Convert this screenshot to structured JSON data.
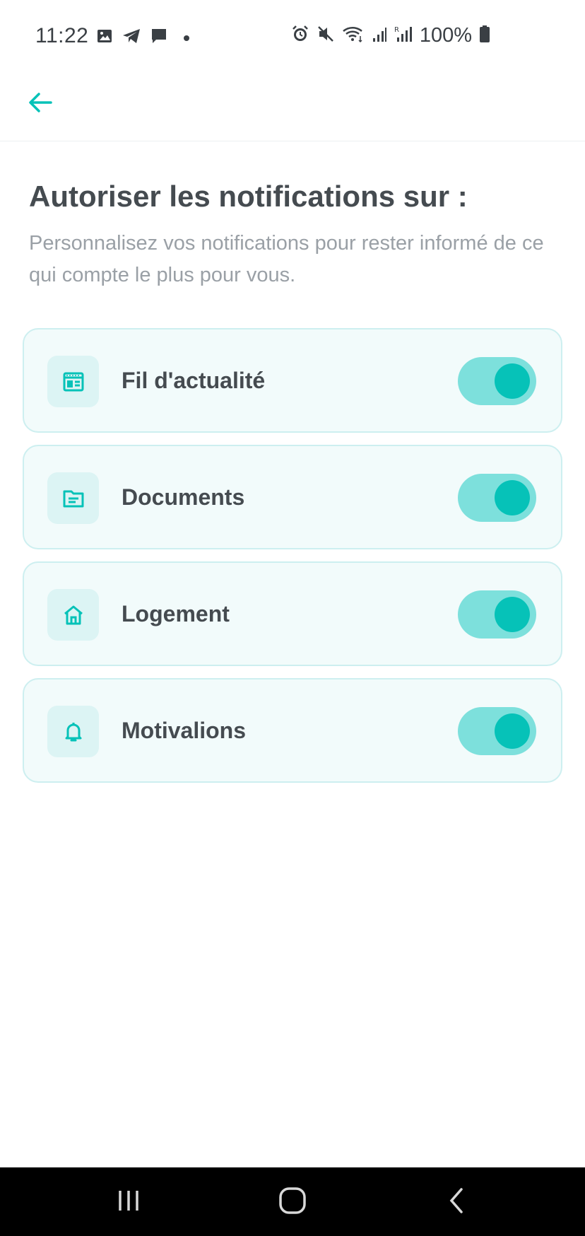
{
  "status_bar": {
    "time": "11:22",
    "left_icons": [
      "image-icon",
      "telegram-icon",
      "message-icon",
      "dot-icon"
    ],
    "right_icons": [
      "alarm-icon",
      "mute-icon",
      "wifi-icon",
      "signal-icon",
      "signal-roaming-icon"
    ],
    "battery_percent": "100%",
    "battery_level": 1.0
  },
  "header": {
    "back_icon": "arrow-left-icon"
  },
  "page": {
    "title": "Autoriser les notifications sur :",
    "subtitle": "Personnalisez vos notifications pour rester informé de ce qui compte le plus pour vous."
  },
  "notifications": [
    {
      "label": "Fil d'actualité",
      "icon": "newspaper-icon",
      "enabled": true
    },
    {
      "label": "Documents",
      "icon": "folder-icon",
      "enabled": true
    },
    {
      "label": "Logement",
      "icon": "home-icon",
      "enabled": true
    },
    {
      "label": "Motivalions",
      "icon": "bell-icon",
      "enabled": true
    }
  ],
  "colors": {
    "accent": "#06c2b8",
    "toggle_track": "#7de0dc",
    "card_bg": "#f2fbfb",
    "card_border": "#cdeff0",
    "icon_bg": "#dcf4f4",
    "title": "#454b50",
    "subtitle": "#9aa0a6"
  },
  "nav_bar": {
    "buttons": [
      "recents-icon",
      "home-button-icon",
      "back-chevron-icon"
    ]
  }
}
